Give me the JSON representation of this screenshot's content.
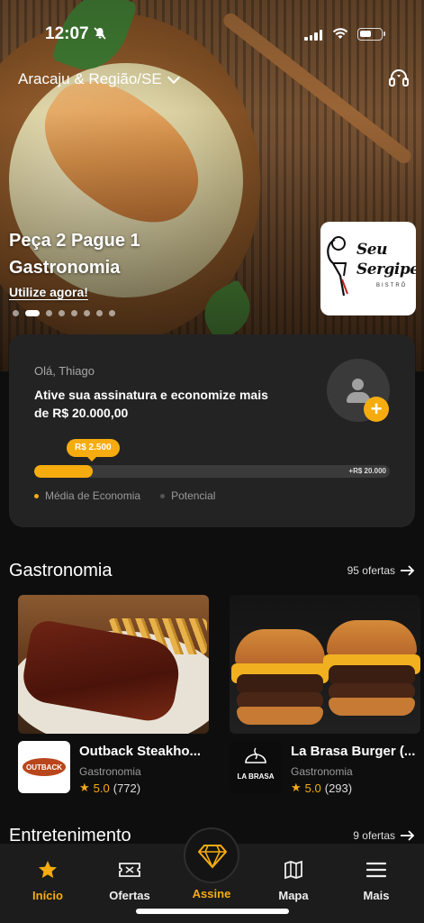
{
  "status_bar": {
    "time": "12:07"
  },
  "header": {
    "region": "Aracaju & Região/SE"
  },
  "hero": {
    "title_line1": "Peça 2 Pague 1",
    "title_line2": "Gastronomia",
    "cta": "Utilize agora!",
    "carousel_total": 8,
    "carousel_active": 1,
    "brand_logo_text_line1": "Seu",
    "brand_logo_text_line2": "Sergipe",
    "brand_logo_sub": "BISTRÔ"
  },
  "subscription": {
    "greeting": "Olá, Thiago",
    "message": "Ative sua assinatura e economize mais de  R$ 20.000,00",
    "savings_label": "R$ 2.500",
    "potential_label": "+R$ 20.000",
    "savings_value": 2500,
    "potential_value": 20000,
    "legend_average": "Média de Economia",
    "legend_potential": "Potencial",
    "colors": {
      "accent": "#f6ac0f",
      "muted": "#555555"
    }
  },
  "sections": [
    {
      "title": "Gastronomia",
      "link": "95 ofertas",
      "cards": [
        {
          "name": "Outback Steakho...",
          "category": "Gastronomia",
          "rating": "5.0",
          "reviews": "(772)",
          "logo_text": "OUTBACK"
        },
        {
          "name": "La Brasa Burger (...",
          "category": "Gastronomia",
          "rating": "5.0",
          "reviews": "(293)",
          "logo_text": "LA BRASA"
        }
      ]
    },
    {
      "title": "Entretenimento",
      "link": "9 ofertas"
    }
  ],
  "tabbar": {
    "items": [
      {
        "label": "Início",
        "icon": "star-icon"
      },
      {
        "label": "Ofertas",
        "icon": "ticket-icon"
      },
      {
        "label": "Assine",
        "icon": "diamond-icon"
      },
      {
        "label": "Mapa",
        "icon": "map-icon"
      },
      {
        "label": "Mais",
        "icon": "menu-icon"
      }
    ]
  }
}
